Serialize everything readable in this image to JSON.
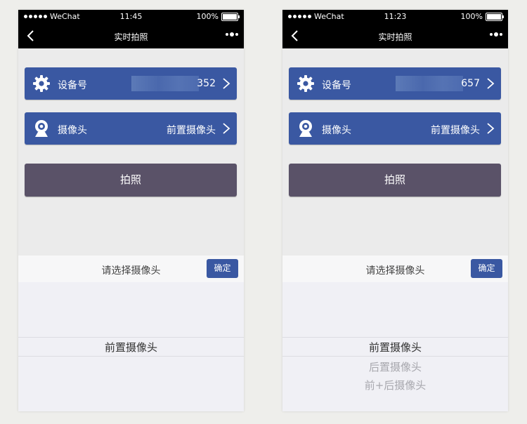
{
  "status_bar": {
    "carrier": "WeChat",
    "battery": "100%"
  },
  "nav": {
    "title": "实时拍照"
  },
  "device_label": "设备号",
  "camera_label": "摄像头",
  "shoot_label": "拍照",
  "picker": {
    "prompt": "请选择摄像头",
    "confirm": "确定"
  },
  "screens": [
    {
      "time": "11:45",
      "device_suffix": "352",
      "camera_value": "前置摄像头",
      "options": [
        "前置摄像头"
      ]
    },
    {
      "time": "11:23",
      "device_suffix": "657",
      "camera_value": "前置摄像头",
      "options": [
        "前置摄像头",
        "后置摄像头",
        "前+后摄像头"
      ]
    }
  ],
  "colors": {
    "accent": "#3a58a2",
    "button": "#5a5268",
    "statusbar": "#000000",
    "page_bg": "#ebebeb"
  },
  "icons": {
    "back": "chevron-left-icon",
    "more": "more-dots-icon",
    "device": "gear-icon",
    "camera": "webcam-icon",
    "row_arrow": "chevron-right-icon"
  }
}
